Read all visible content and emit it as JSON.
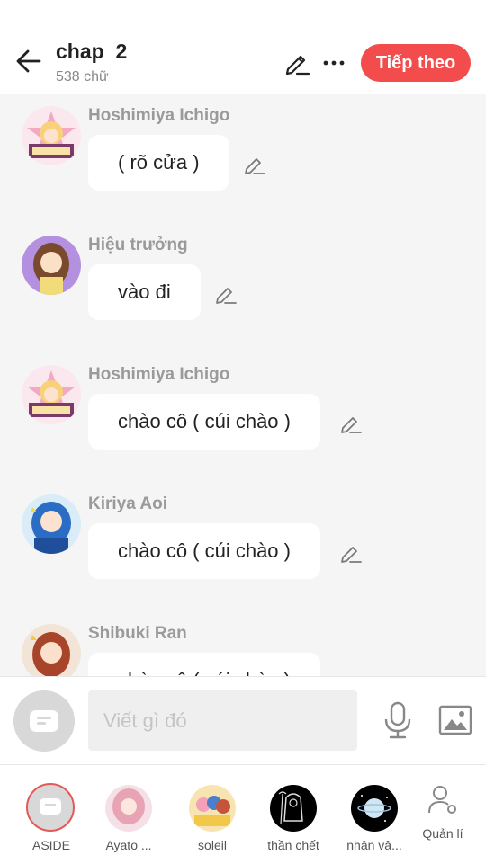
{
  "header": {
    "title": "chap  2",
    "word_count": "538 chữ",
    "next_label": "Tiếp theo",
    "accent": "#f24c4c"
  },
  "messages": [
    {
      "sender": "Hoshimiya Ichigo",
      "text": "( rõ cửa )",
      "avatar_icon": "ichigo-avatar-icon"
    },
    {
      "sender": "Hiệu trưởng",
      "text": "vào đi",
      "avatar_icon": "principal-avatar-icon"
    },
    {
      "sender": "Hoshimiya Ichigo",
      "text": "chào cô ( cúi chào )",
      "avatar_icon": "ichigo-avatar-icon"
    },
    {
      "sender": "Kiriya Aoi",
      "text": "chào cô ( cúi chào )",
      "avatar_icon": "aoi-avatar-icon"
    },
    {
      "sender": "Shibuki Ran",
      "text": "chào cô ( cúi chào )",
      "avatar_icon": "ran-avatar-icon"
    }
  ],
  "composer": {
    "placeholder": "Viết gì đó",
    "icons": [
      "aside-icon",
      "microphone-icon",
      "image-icon"
    ]
  },
  "characters": [
    {
      "label": "ASIDE"
    },
    {
      "label": "Ayato ..."
    },
    {
      "label": "soleil"
    },
    {
      "label": "thần chết"
    },
    {
      "label": "nhân vậ..."
    },
    {
      "label": "Quản lí"
    }
  ]
}
